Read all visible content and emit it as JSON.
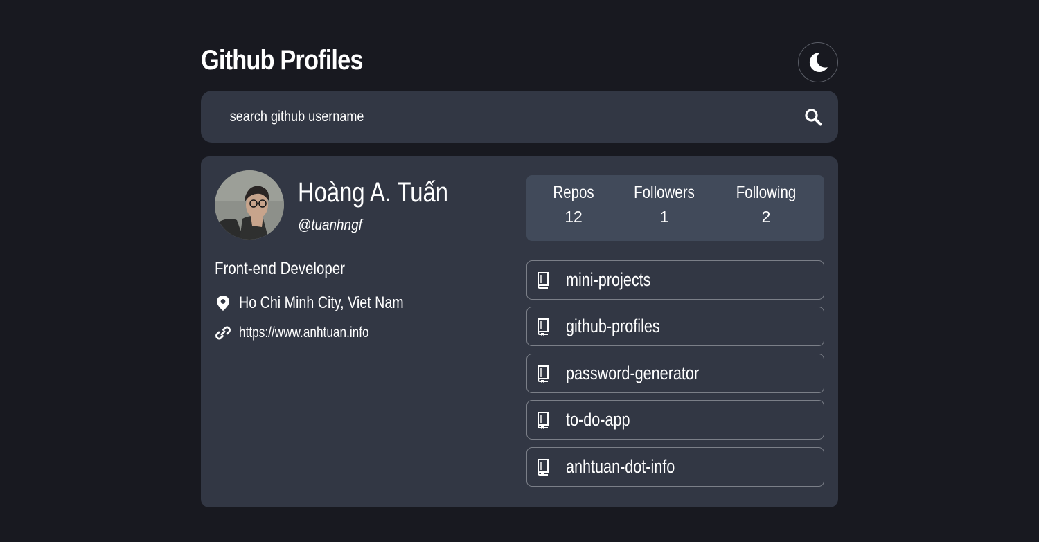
{
  "header": {
    "title": "Github Profiles",
    "theme_icon": "moon-icon"
  },
  "search": {
    "placeholder": "search github username",
    "value": "",
    "icon": "search-icon"
  },
  "profile": {
    "name": "Hoàng A. Tuấn",
    "username": "@tuanhngf",
    "bio": "Front-end Developer",
    "location": "Ho Chi Minh City, Viet Nam",
    "location_icon": "map-pin-icon",
    "website": "https://www.anhtuan.info",
    "website_icon": "link-icon"
  },
  "stats": [
    {
      "label": "Repos",
      "value": "12"
    },
    {
      "label": "Followers",
      "value": "1"
    },
    {
      "label": "Following",
      "value": "2"
    }
  ],
  "repos": [
    {
      "name": "mini-projects",
      "icon": "book-icon"
    },
    {
      "name": "github-profiles",
      "icon": "book-icon"
    },
    {
      "name": "password-generator",
      "icon": "book-icon"
    },
    {
      "name": "to-do-app",
      "icon": "book-icon"
    },
    {
      "name": "anhtuan-dot-info",
      "icon": "book-icon"
    }
  ],
  "colors": {
    "background": "#181920",
    "card": "#323744",
    "stats_panel": "#414a5a",
    "text": "#ffffff",
    "border": "#7b7f88"
  }
}
